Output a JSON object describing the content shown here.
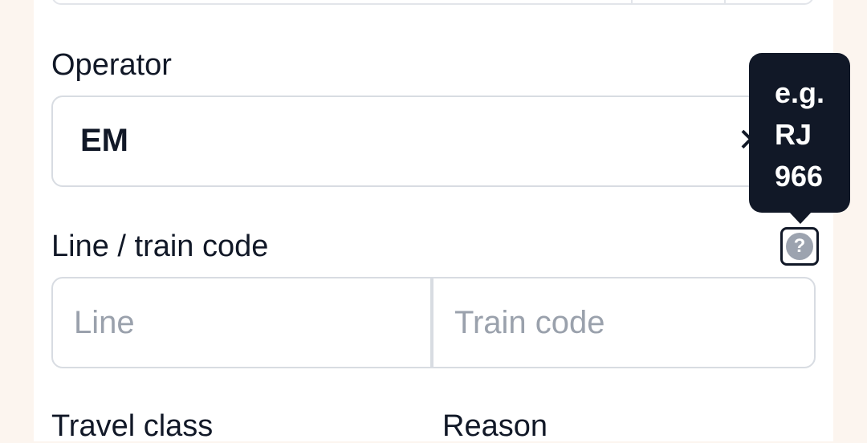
{
  "operator": {
    "label": "Operator",
    "value": "EM",
    "clear_symbol": "✕"
  },
  "line_train": {
    "label": "Line / train code",
    "help_symbol": "?",
    "line_placeholder": "Line",
    "train_code_placeholder": "Train code"
  },
  "tooltip": {
    "lines": [
      "e.g.",
      "RJ",
      "966"
    ]
  },
  "travel_class": {
    "label": "Travel class"
  },
  "reason": {
    "label": "Reason"
  }
}
